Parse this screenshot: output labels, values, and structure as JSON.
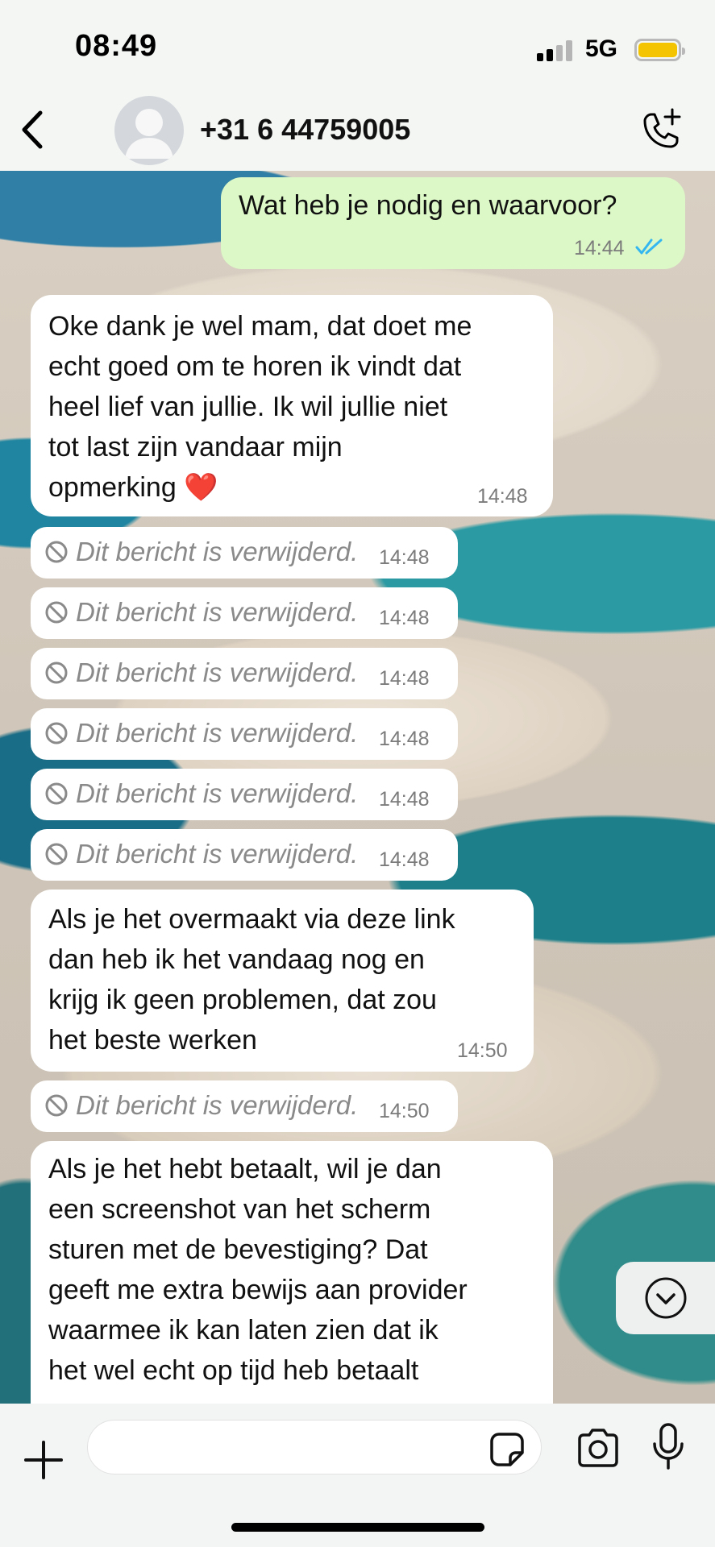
{
  "status_bar": {
    "time": "08:49",
    "network": "5G",
    "battery_color": "#f5c400"
  },
  "header": {
    "contact": "+31 6 44759005",
    "icons": [
      "back-chevron-icon",
      "avatar-icon",
      "add-call-icon"
    ]
  },
  "messages": [
    {
      "direction": "outgoing",
      "text": "Wat heb je nodig en waarvoor?",
      "time": "14:44",
      "status": "read"
    },
    {
      "direction": "incoming",
      "text": "Oke dank je wel mam, dat doet me\necht goed om te horen ik vindt dat\nheel lief van jullie. Ik wil jullie niet\ntot last zijn vandaar mijn\nopmerking",
      "emoji": "❤️",
      "time": "14:48"
    },
    {
      "direction": "incoming",
      "deleted": true,
      "text": "Dit bericht is verwijderd.",
      "time": "14:48"
    },
    {
      "direction": "incoming",
      "deleted": true,
      "text": "Dit bericht is verwijderd.",
      "time": "14:48"
    },
    {
      "direction": "incoming",
      "deleted": true,
      "text": "Dit bericht is verwijderd.",
      "time": "14:48"
    },
    {
      "direction": "incoming",
      "deleted": true,
      "text": "Dit bericht is verwijderd.",
      "time": "14:48"
    },
    {
      "direction": "incoming",
      "deleted": true,
      "text": "Dit bericht is verwijderd.",
      "time": "14:48"
    },
    {
      "direction": "incoming",
      "deleted": true,
      "text": "Dit bericht is verwijderd.",
      "time": "14:48"
    },
    {
      "direction": "incoming",
      "text": "Als je het overmaakt via deze link\ndan heb ik het vandaag nog en\nkrijg ik geen problemen, dat zou\nhet beste werken",
      "time": "14:50"
    },
    {
      "direction": "incoming",
      "deleted": true,
      "text": "Dit bericht is verwijderd.",
      "time": "14:50"
    },
    {
      "direction": "incoming",
      "text": "Als je het hebt betaalt, wil je dan\neen screenshot van het scherm\nsturen met de bevestiging? Dat\ngeeft me extra bewijs aan provider\nwaarmee ik kan laten zien dat ik\nhet wel echt op tijd heb betaalt"
    }
  ],
  "input_bar": {
    "message_value": "",
    "icons": [
      "plus-icon",
      "sticker-icon",
      "camera-icon",
      "microphone-icon"
    ]
  },
  "colors": {
    "outgoing_bubble": "#dcf8c6",
    "incoming_bubble": "#ffffff",
    "read_ticks": "#34b7f1"
  }
}
